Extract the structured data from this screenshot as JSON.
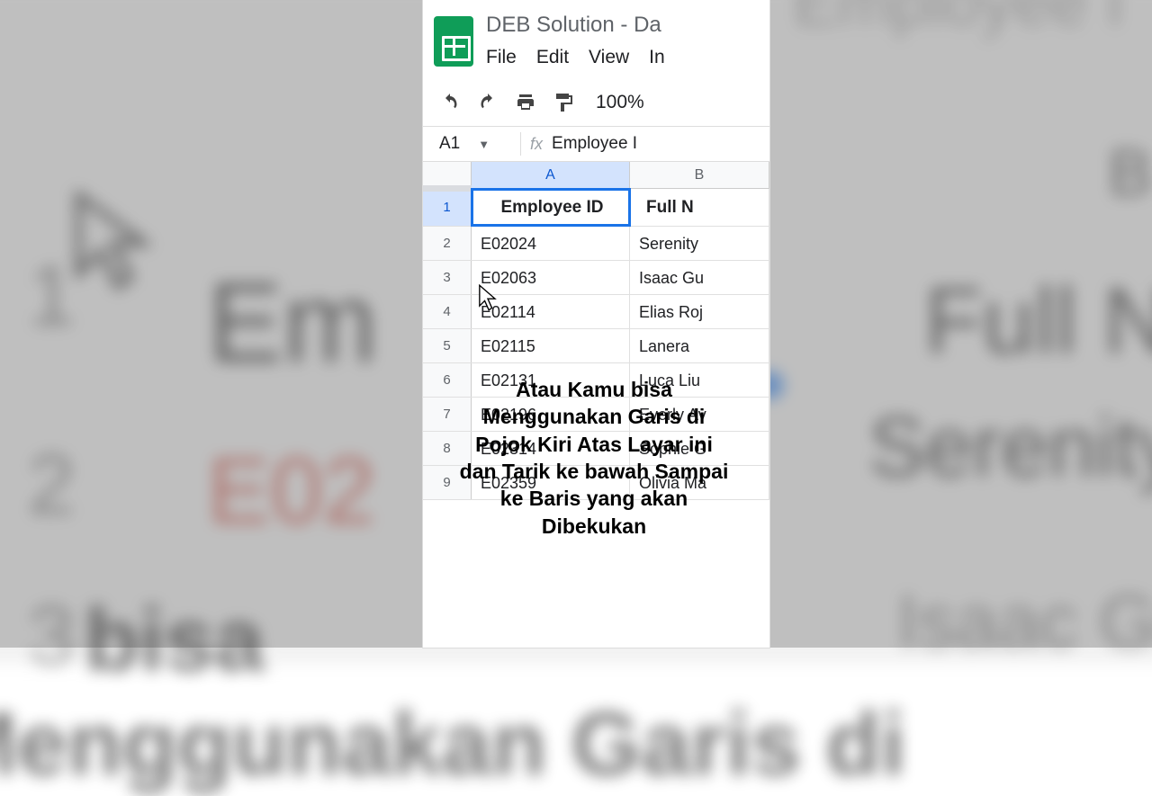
{
  "doc": {
    "title": "DEB Solution - Da",
    "menus": {
      "file": "File",
      "edit": "Edit",
      "view": "View",
      "insert": "In"
    }
  },
  "toolbar": {
    "zoom": "100%"
  },
  "namebox": {
    "ref": "A1"
  },
  "formula": {
    "fx": "fx",
    "content": "Employee I"
  },
  "columns": {
    "a": "A",
    "b": "B"
  },
  "rows": [
    {
      "num": "1",
      "a": "Employee ID",
      "b": "Full N"
    },
    {
      "num": "2",
      "a": "E02024",
      "b": "Serenity"
    },
    {
      "num": "3",
      "a": "E02063",
      "b": "Isaac Gu"
    },
    {
      "num": "4",
      "a": "E02114",
      "b": "Elias Roj"
    },
    {
      "num": "5",
      "a": "E02115",
      "b": "Lanera"
    },
    {
      "num": "6",
      "a": "E02131",
      "b": "Luca Liu"
    },
    {
      "num": "7",
      "a": "E02196",
      "b": "Everly Av"
    },
    {
      "num": "8",
      "a": "E02314",
      "b": "Sophie G"
    },
    {
      "num": "9",
      "a": "E02359",
      "b": "Olivia Ma"
    }
  ],
  "subtitle": {
    "l1": "Atau Kamu bisa",
    "l2": "Menggunakan Garis di",
    "l3": "Pojok Kiri Atas Layar ini",
    "l4": "dan Tarik ke bawah Sampai",
    "l5": "ke Baris yang akan",
    "l6": "Dibekukan"
  },
  "bg": {
    "title": "Employee I",
    "colB": "B",
    "r1": "1",
    "r2": "2",
    "r3": "3",
    "emp": "Em",
    "fulln": "Full N",
    "e02": "E02",
    "seren": "Serenity",
    "gu": "Isaac Gu",
    "atau": "bisa",
    "garis": "Menggunakan Garis di"
  }
}
